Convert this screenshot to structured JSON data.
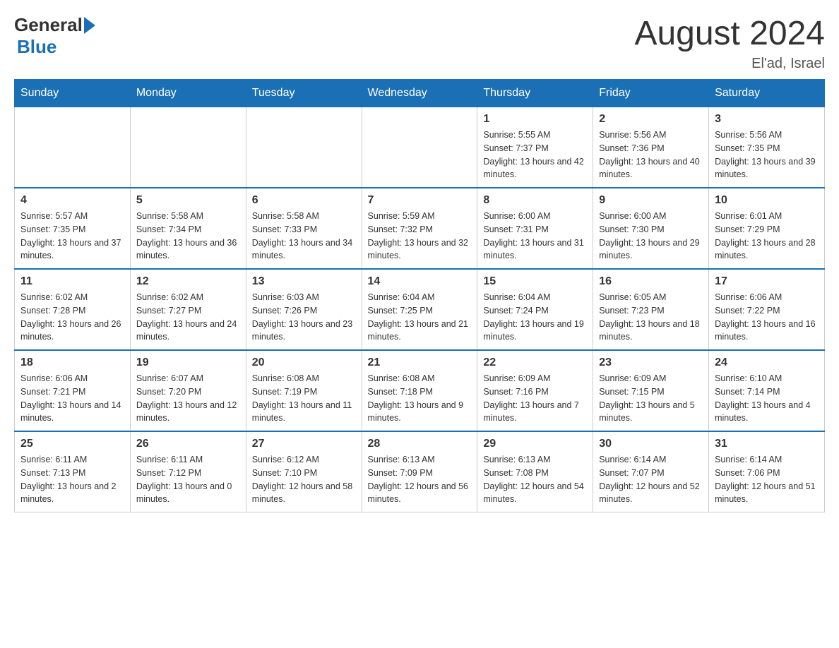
{
  "header": {
    "logo": {
      "general": "General",
      "blue": "Blue"
    },
    "title": "August 2024",
    "location": "El'ad, Israel"
  },
  "days_of_week": [
    "Sunday",
    "Monday",
    "Tuesday",
    "Wednesday",
    "Thursday",
    "Friday",
    "Saturday"
  ],
  "weeks": [
    [
      {
        "day": "",
        "info": ""
      },
      {
        "day": "",
        "info": ""
      },
      {
        "day": "",
        "info": ""
      },
      {
        "day": "",
        "info": ""
      },
      {
        "day": "1",
        "info": "Sunrise: 5:55 AM\nSunset: 7:37 PM\nDaylight: 13 hours and 42 minutes."
      },
      {
        "day": "2",
        "info": "Sunrise: 5:56 AM\nSunset: 7:36 PM\nDaylight: 13 hours and 40 minutes."
      },
      {
        "day": "3",
        "info": "Sunrise: 5:56 AM\nSunset: 7:35 PM\nDaylight: 13 hours and 39 minutes."
      }
    ],
    [
      {
        "day": "4",
        "info": "Sunrise: 5:57 AM\nSunset: 7:35 PM\nDaylight: 13 hours and 37 minutes."
      },
      {
        "day": "5",
        "info": "Sunrise: 5:58 AM\nSunset: 7:34 PM\nDaylight: 13 hours and 36 minutes."
      },
      {
        "day": "6",
        "info": "Sunrise: 5:58 AM\nSunset: 7:33 PM\nDaylight: 13 hours and 34 minutes."
      },
      {
        "day": "7",
        "info": "Sunrise: 5:59 AM\nSunset: 7:32 PM\nDaylight: 13 hours and 32 minutes."
      },
      {
        "day": "8",
        "info": "Sunrise: 6:00 AM\nSunset: 7:31 PM\nDaylight: 13 hours and 31 minutes."
      },
      {
        "day": "9",
        "info": "Sunrise: 6:00 AM\nSunset: 7:30 PM\nDaylight: 13 hours and 29 minutes."
      },
      {
        "day": "10",
        "info": "Sunrise: 6:01 AM\nSunset: 7:29 PM\nDaylight: 13 hours and 28 minutes."
      }
    ],
    [
      {
        "day": "11",
        "info": "Sunrise: 6:02 AM\nSunset: 7:28 PM\nDaylight: 13 hours and 26 minutes."
      },
      {
        "day": "12",
        "info": "Sunrise: 6:02 AM\nSunset: 7:27 PM\nDaylight: 13 hours and 24 minutes."
      },
      {
        "day": "13",
        "info": "Sunrise: 6:03 AM\nSunset: 7:26 PM\nDaylight: 13 hours and 23 minutes."
      },
      {
        "day": "14",
        "info": "Sunrise: 6:04 AM\nSunset: 7:25 PM\nDaylight: 13 hours and 21 minutes."
      },
      {
        "day": "15",
        "info": "Sunrise: 6:04 AM\nSunset: 7:24 PM\nDaylight: 13 hours and 19 minutes."
      },
      {
        "day": "16",
        "info": "Sunrise: 6:05 AM\nSunset: 7:23 PM\nDaylight: 13 hours and 18 minutes."
      },
      {
        "day": "17",
        "info": "Sunrise: 6:06 AM\nSunset: 7:22 PM\nDaylight: 13 hours and 16 minutes."
      }
    ],
    [
      {
        "day": "18",
        "info": "Sunrise: 6:06 AM\nSunset: 7:21 PM\nDaylight: 13 hours and 14 minutes."
      },
      {
        "day": "19",
        "info": "Sunrise: 6:07 AM\nSunset: 7:20 PM\nDaylight: 13 hours and 12 minutes."
      },
      {
        "day": "20",
        "info": "Sunrise: 6:08 AM\nSunset: 7:19 PM\nDaylight: 13 hours and 11 minutes."
      },
      {
        "day": "21",
        "info": "Sunrise: 6:08 AM\nSunset: 7:18 PM\nDaylight: 13 hours and 9 minutes."
      },
      {
        "day": "22",
        "info": "Sunrise: 6:09 AM\nSunset: 7:16 PM\nDaylight: 13 hours and 7 minutes."
      },
      {
        "day": "23",
        "info": "Sunrise: 6:09 AM\nSunset: 7:15 PM\nDaylight: 13 hours and 5 minutes."
      },
      {
        "day": "24",
        "info": "Sunrise: 6:10 AM\nSunset: 7:14 PM\nDaylight: 13 hours and 4 minutes."
      }
    ],
    [
      {
        "day": "25",
        "info": "Sunrise: 6:11 AM\nSunset: 7:13 PM\nDaylight: 13 hours and 2 minutes."
      },
      {
        "day": "26",
        "info": "Sunrise: 6:11 AM\nSunset: 7:12 PM\nDaylight: 13 hours and 0 minutes."
      },
      {
        "day": "27",
        "info": "Sunrise: 6:12 AM\nSunset: 7:10 PM\nDaylight: 12 hours and 58 minutes."
      },
      {
        "day": "28",
        "info": "Sunrise: 6:13 AM\nSunset: 7:09 PM\nDaylight: 12 hours and 56 minutes."
      },
      {
        "day": "29",
        "info": "Sunrise: 6:13 AM\nSunset: 7:08 PM\nDaylight: 12 hours and 54 minutes."
      },
      {
        "day": "30",
        "info": "Sunrise: 6:14 AM\nSunset: 7:07 PM\nDaylight: 12 hours and 52 minutes."
      },
      {
        "day": "31",
        "info": "Sunrise: 6:14 AM\nSunset: 7:06 PM\nDaylight: 12 hours and 51 minutes."
      }
    ]
  ]
}
